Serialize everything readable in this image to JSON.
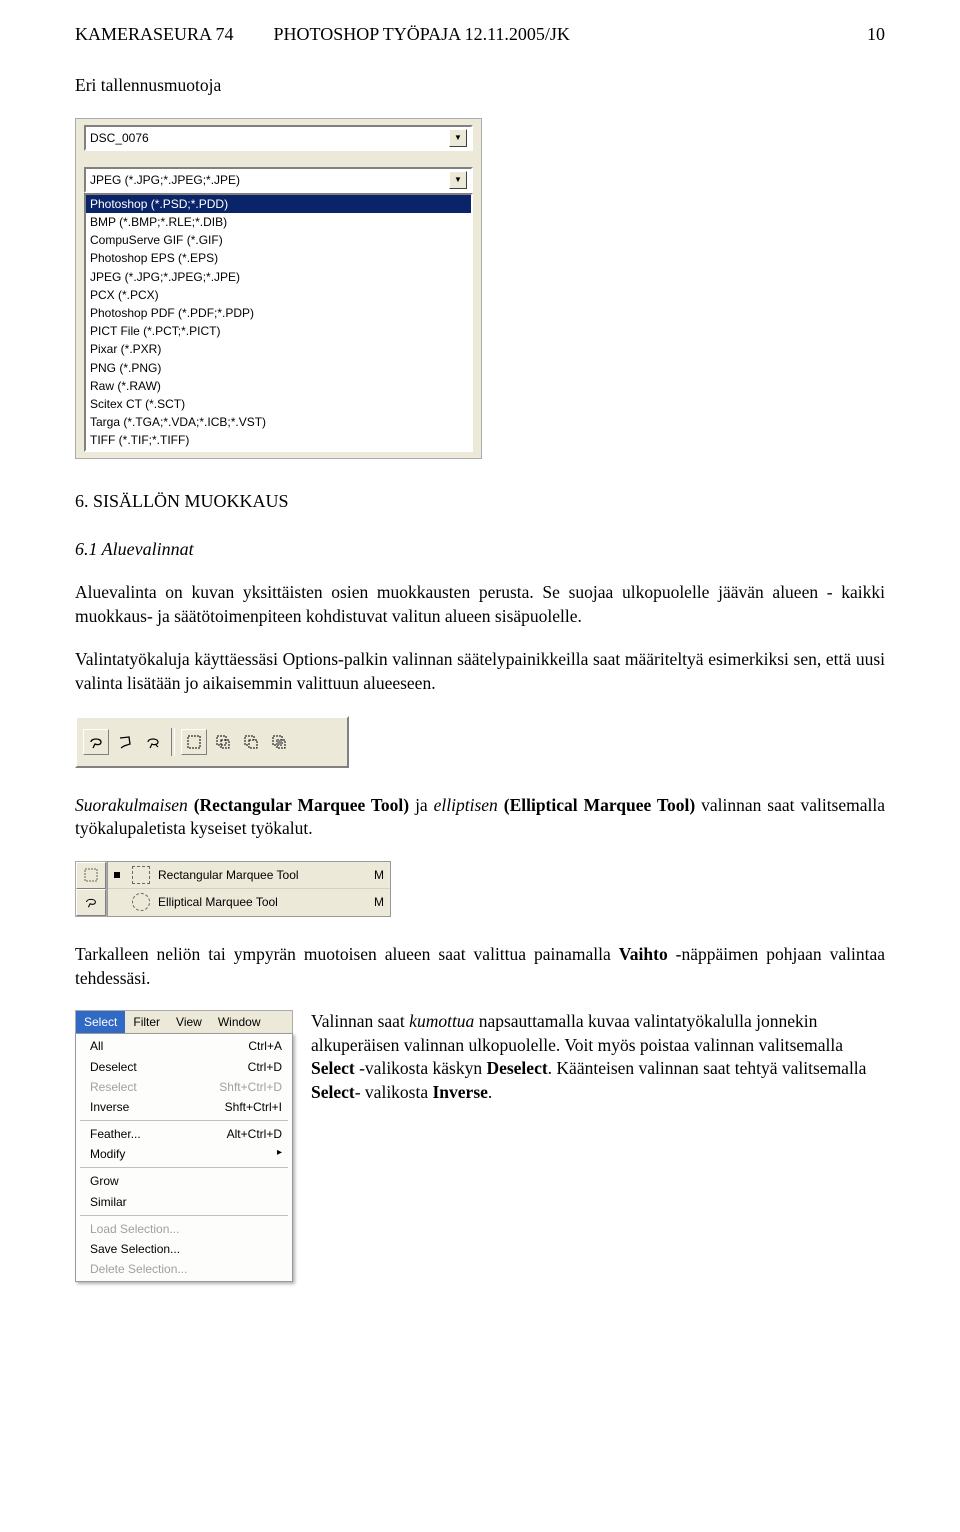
{
  "header": {
    "left": "KAMERASEURA 74",
    "center": "PHOTOSHOP TYÖPAJA 12.11.2005/JK",
    "right": "10"
  },
  "intro": "Eri tallennusmuotoja",
  "save_dialog": {
    "filename": "DSC_0076",
    "filter_selected": "JPEG (*.JPG;*.JPEG;*.JPE)",
    "formats": [
      "Photoshop (*.PSD;*.PDD)",
      "BMP (*.BMP;*.RLE;*.DIB)",
      "CompuServe GIF (*.GIF)",
      "Photoshop EPS (*.EPS)",
      "JPEG (*.JPG;*.JPEG;*.JPE)",
      "PCX (*.PCX)",
      "Photoshop PDF (*.PDF;*.PDP)",
      "PICT File (*.PCT;*.PICT)",
      "Pixar (*.PXR)",
      "PNG (*.PNG)",
      "Raw (*.RAW)",
      "Scitex CT (*.SCT)",
      "Targa (*.TGA;*.VDA;*.ICB;*.VST)",
      "TIFF (*.TIF;*.TIFF)"
    ]
  },
  "sec6": {
    "title": "6. SISÄLLÖN MUOKKAUS",
    "sub61": "6.1 Aluevalinnat",
    "p1": "Aluevalinta on kuvan yksittäisten osien muokkausten perusta. Se suojaa ulkopuolelle jäävän alueen - kaikki muokkaus- ja säätötoimenpiteen kohdistuvat valitun alueen sisäpuolelle.",
    "p2": "Valintatyökaluja käyttäessäsi Options-palkin valinnan säätelypainikkeilla saat määriteltyä esimerkiksi sen, että uusi valinta lisätään jo aikaisemmin valittuun alueeseen.",
    "p3_pre_i1": "Suorakulmaisen",
    "p3_b1": " (Rectangular Marquee Tool) ",
    "p3_mid": "ja ",
    "p3_i2": "elliptisen",
    "p3_b2": " (Elliptical Marquee Tool) ",
    "p3_end": "valinnan saat valitsemalla työkalupaletista kyseiset työkalut.",
    "p4_a": "Tarkalleen neliön tai ympyrän muotoisen alueen saat valittua painamalla ",
    "p4_b": "Vaihto",
    "p4_c": " -näppäimen pohjaan valintaa tehdessäsi.",
    "p5_a": "Valinnan saat ",
    "p5_i": "kumottua",
    "p5_b": " napsauttamalla kuvaa valintatyökalulla jonnekin alkuperäisen valinnan ulkopuolelle. Voit myös poistaa valinnan valitsemalla ",
    "p5_c": "Select",
    "p5_d": " -valikosta käskyn ",
    "p5_e": "Deselect",
    "p5_f": ". Käänteisen valinnan saat tehtyä valitsemalla ",
    "p5_g": "Select",
    "p5_h": "- valikosta ",
    "p5_j": "Inverse",
    "p5_k": "."
  },
  "marquee_flyout": {
    "item1": "Rectangular Marquee Tool",
    "item2": "Elliptical Marquee Tool",
    "shortcut": "M"
  },
  "select_menu": {
    "menubar": [
      "Select",
      "Filter",
      "View",
      "Window"
    ],
    "items": [
      {
        "label": "All",
        "accel": "Ctrl+A",
        "disabled": false
      },
      {
        "label": "Deselect",
        "accel": "Ctrl+D",
        "disabled": false
      },
      {
        "label": "Reselect",
        "accel": "Shft+Ctrl+D",
        "disabled": true
      },
      {
        "label": "Inverse",
        "accel": "Shft+Ctrl+I",
        "disabled": false
      },
      {
        "sep": true
      },
      {
        "label": "Feather...",
        "accel": "Alt+Ctrl+D",
        "disabled": false
      },
      {
        "label": "Modify",
        "accel": "▸",
        "disabled": false
      },
      {
        "sep": true
      },
      {
        "label": "Grow",
        "accel": "",
        "disabled": false
      },
      {
        "label": "Similar",
        "accel": "",
        "disabled": false
      },
      {
        "sep": true
      },
      {
        "label": "Load Selection...",
        "accel": "",
        "disabled": true
      },
      {
        "label": "Save Selection...",
        "accel": "",
        "disabled": false
      },
      {
        "label": "Delete Selection...",
        "accel": "",
        "disabled": true
      }
    ]
  }
}
